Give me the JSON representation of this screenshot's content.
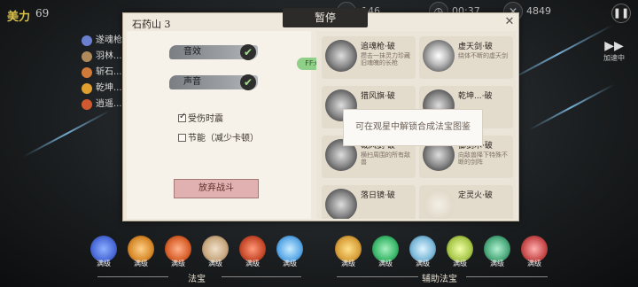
{
  "hud": {
    "level_label": "美力",
    "level_value": "69",
    "stat_mid": "146",
    "time_value": "00:37",
    "kills_value": "4849",
    "pause_icon": "pause-icon"
  },
  "buffs": [
    {
      "label": "遂魂枪",
      "color": "#6a7fd0"
    },
    {
      "label": "羽林...",
      "color": "#b08a5a"
    },
    {
      "label": "斩石...",
      "color": "#d07a3a"
    },
    {
      "label": "乾坤...",
      "color": "#e0a030"
    },
    {
      "label": "逍遥...",
      "color": "#d05a30"
    }
  ],
  "accelerate": {
    "label": "加速中"
  },
  "dialog": {
    "title": "暂停",
    "level_name": "石药山 3",
    "close_icon": "close-icon",
    "toggles": [
      {
        "label": "音效",
        "checked": true
      },
      {
        "label": "声音",
        "checked": true
      }
    ],
    "options": [
      {
        "label": "受伤时震",
        "checked": true
      },
      {
        "label": "节能（减少卡顿）",
        "checked": false
      }
    ],
    "quit_label": "放弃战斗",
    "badge_label": "FF:66",
    "tooltip": "可在观星中解锁合成法宝图鉴",
    "cards": [
      {
        "name": "追魂枪·破",
        "desc": "攒击一抹灵力珍藏旧魂魄的长枪"
      },
      {
        "name": "虚天剑·破",
        "desc": "绕体不断的虚天剑"
      },
      {
        "name": "猎风旗·破",
        "desc": ""
      },
      {
        "name": "乾坤...·破",
        "desc": ""
      },
      {
        "name": "裁风剑·破",
        "desc": "横扫周围的所有敌兽"
      },
      {
        "name": "御剑术·破",
        "desc": "向敌兽降下特殊不断的剑阵"
      },
      {
        "name": "落日镜·破",
        "desc": ""
      },
      {
        "name": "定灵火·破",
        "desc": ""
      }
    ]
  },
  "skills_main": {
    "label": "法宝",
    "items": [
      {
        "level": "满级",
        "color": "#4a6ad8"
      },
      {
        "level": "满级",
        "color": "#d88a2a"
      },
      {
        "level": "满级",
        "color": "#d8602a"
      },
      {
        "level": "满级",
        "color": "#c8a880"
      },
      {
        "level": "满级",
        "color": "#c84a2a"
      },
      {
        "level": "满级",
        "color": "#5aa8e8"
      }
    ]
  },
  "skills_aux": {
    "label": "辅助法宝",
    "items": [
      {
        "level": "满级",
        "color": "#d8a03a"
      },
      {
        "level": "满级",
        "color": "#3ab86a"
      },
      {
        "level": "满级",
        "color": "#7ab8d8"
      },
      {
        "level": "满级",
        "color": "#a8c84a"
      },
      {
        "level": "满级",
        "color": "#4aa87a"
      },
      {
        "level": "满级",
        "color": "#c84a4a"
      }
    ]
  }
}
